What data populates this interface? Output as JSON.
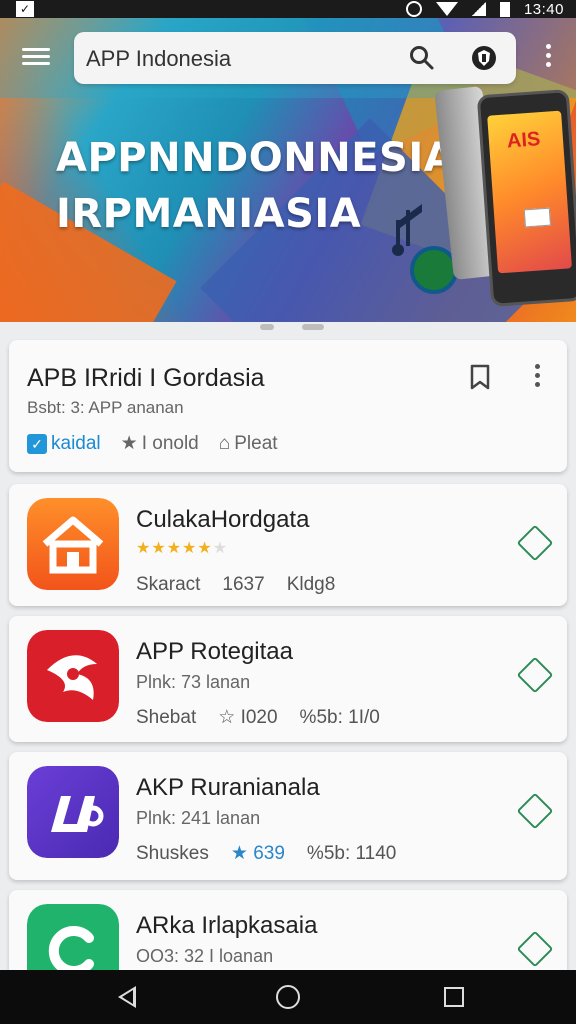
{
  "status_bar": {
    "time": "13:40"
  },
  "search": {
    "value": "APP Indonesia"
  },
  "hero": {
    "line1": "APPNNDONNESIA",
    "line2": "IRPMANIASIA",
    "phone_logo": "AIS"
  },
  "featured": {
    "title": "APB IRridi I Gordasia",
    "subtitle": "Bsbt: 3: APP ananan",
    "chips": [
      {
        "label": "kaidal",
        "icon": "check-icon",
        "color": "#2196d9"
      },
      {
        "label": "I onold",
        "icon": "star-icon"
      },
      {
        "label": "Pleat",
        "icon": "tag-icon"
      }
    ]
  },
  "apps": [
    {
      "title": "CulakaHordgata",
      "subtitle": "",
      "rating": 4.5,
      "meta": [
        "Skaract",
        "1637",
        "Kldg8"
      ],
      "icon": "house-icon",
      "icon_color": "#f5661c"
    },
    {
      "title": "APP Rotegitaa",
      "subtitle": "Plnk: 73 lanan",
      "meta": [
        "Shebat",
        "I020",
        "5b: 1I/0"
      ],
      "meta_icons": [
        "",
        "star-icon",
        "percent-icon"
      ],
      "icon": "swirl-icon",
      "icon_color": "#d91f2a"
    },
    {
      "title": "AKP Ruranianala",
      "subtitle": "Plnk: 241 lanan",
      "meta": [
        "Shuskes",
        "639",
        "5b: 1140"
      ],
      "meta_icons": [
        "",
        "star-icon",
        "percent-icon"
      ],
      "icon": "logo-icon",
      "icon_color": "#5a34c4"
    },
    {
      "title": "ARka Irlapkasaia",
      "subtitle": "OO3: 32 I loanan",
      "meta": [],
      "icon": "c-icon",
      "icon_color": "#1fb36b"
    }
  ],
  "colors": {
    "accent": "#2196d9",
    "install": "#2e8b57",
    "rating": "#f2b01e"
  }
}
